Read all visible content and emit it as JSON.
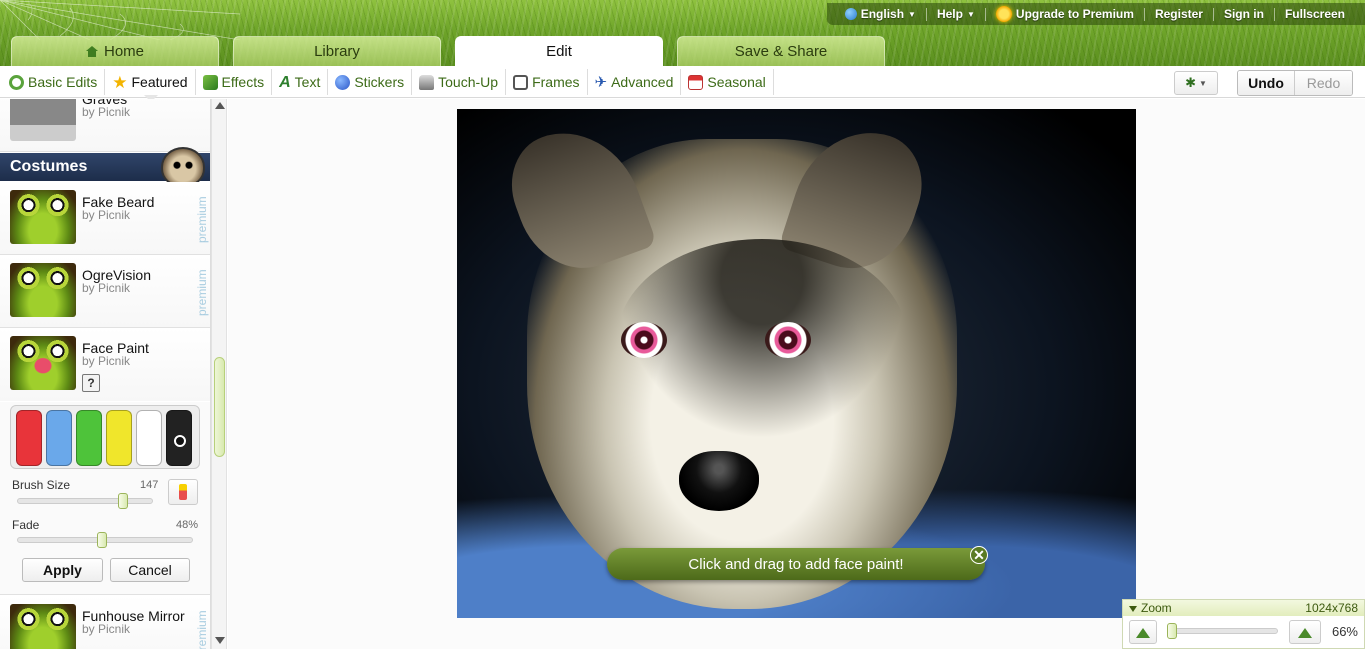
{
  "top_links": {
    "language": "English",
    "help": "Help",
    "upgrade": "Upgrade to Premium",
    "register": "Register",
    "sign_in": "Sign in",
    "fullscreen": "Fullscreen"
  },
  "main_tabs": [
    {
      "label": "Home",
      "icon": "home-icon",
      "active": false
    },
    {
      "label": "Library",
      "active": false
    },
    {
      "label": "Edit",
      "active": true
    },
    {
      "label": "Save & Share",
      "active": false
    }
  ],
  "edit_tabs": [
    {
      "label": "Basic Edits",
      "icon": "basic-edits-icon"
    },
    {
      "label": "Featured",
      "icon": "star-icon",
      "active": true
    },
    {
      "label": "Effects",
      "icon": "effects-icon"
    },
    {
      "label": "Text",
      "icon": "text-icon"
    },
    {
      "label": "Stickers",
      "icon": "stickers-icon"
    },
    {
      "label": "Touch-Up",
      "icon": "touch-up-icon"
    },
    {
      "label": "Frames",
      "icon": "frames-icon"
    },
    {
      "label": "Advanced",
      "icon": "advanced-icon"
    },
    {
      "label": "Seasonal",
      "icon": "seasonal-icon"
    }
  ],
  "actions": {
    "undo": "Undo",
    "redo": "Redo"
  },
  "panel": {
    "graves": {
      "title": "Graves",
      "by": "by Picnik"
    },
    "section": "Costumes",
    "effects": [
      {
        "title": "Fake Beard",
        "by": "by Picnik",
        "badge": "premium"
      },
      {
        "title": "OgreVision",
        "by": "by Picnik",
        "badge": "premium"
      },
      {
        "title": "Face Paint",
        "by": "by Picnik",
        "help": "?"
      },
      {
        "title": "Funhouse Mirror",
        "by": "by Picnik",
        "badge": "premium"
      }
    ],
    "face_paint": {
      "colors": [
        "#e8343a",
        "#6aa8ea",
        "#4ec33a",
        "#f0e62b",
        "#ffffff",
        "#222222"
      ],
      "selected_color": 5,
      "brush_label": "Brush Size",
      "brush_value": "147",
      "brush_fraction": 0.78,
      "fade_label": "Fade",
      "fade_value": "48%",
      "fade_fraction": 0.48,
      "apply": "Apply",
      "cancel": "Cancel"
    }
  },
  "canvas": {
    "hint": "Click and drag to add face paint!"
  },
  "zoom": {
    "label": "Zoom",
    "dimensions": "1024x768",
    "value": "66%",
    "fraction": 0.0
  }
}
